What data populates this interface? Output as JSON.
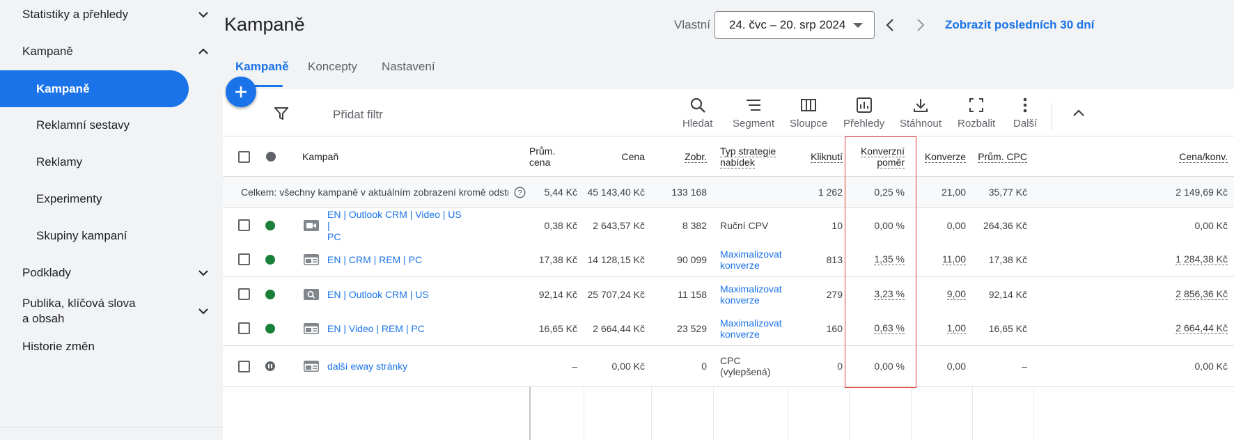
{
  "sidebar": {
    "items": [
      {
        "label": "Statistiky a přehledy",
        "chevron": "down"
      },
      {
        "label": "Kampaně",
        "chevron": "up"
      },
      {
        "label": "Kampaně",
        "active": true
      },
      {
        "label": "Reklamní sestavy"
      },
      {
        "label": "Reklamy"
      },
      {
        "label": "Experimenty"
      },
      {
        "label": "Skupiny kampaní"
      },
      {
        "label": "Podklady",
        "chevron": "down"
      },
      {
        "label": "Publika, klíčová slova",
        "label2": "a obsah",
        "chevron": "down"
      },
      {
        "label": "Historie změn"
      }
    ]
  },
  "header": {
    "title": "Kampaně",
    "date_label": "Vlastní",
    "date_range": "24. čvc – 20. srp 2024",
    "show_last": "Zobrazit posledních 30 dní"
  },
  "tabs": [
    {
      "label": "Kampaně",
      "active": true
    },
    {
      "label": "Koncepty"
    },
    {
      "label": "Nastavení"
    }
  ],
  "toolbar": {
    "add_filter": "Přidat filtr",
    "buttons": [
      {
        "label": "Hledat",
        "icon": "search-icon"
      },
      {
        "label": "Segment",
        "icon": "segment-icon"
      },
      {
        "label": "Sloupce",
        "icon": "columns-icon"
      },
      {
        "label": "Přehledy",
        "icon": "reports-icon"
      },
      {
        "label": "Stáhnout",
        "icon": "download-icon"
      },
      {
        "label": "Rozbalit",
        "icon": "expand-icon"
      },
      {
        "label": "Další",
        "icon": "more-icon"
      }
    ]
  },
  "table": {
    "headers": {
      "campaign": "Kampaň",
      "avg_cost": "Prům. cena",
      "cost": "Cena",
      "impr": "Zobr.",
      "bid_strategy_1": "Typ strategie",
      "bid_strategy_2": "nabídek",
      "clicks": "Kliknutí",
      "conv_rate_1": "Konverzní",
      "conv_rate_2": "poměr",
      "conversions": "Konverze",
      "avg_cpc": "Prům. CPC",
      "cost_conv": "Cena/konv."
    },
    "total": {
      "label": "Celkem: všechny kampaně v aktuálním zobrazení kromě odstra…",
      "avg_cost": "5,44 Kč",
      "cost": "45 143,40 Kč",
      "impr": "133 168",
      "bid": "",
      "clicks": "1 262",
      "conv_rate": "0,25 %",
      "conversions": "21,00",
      "avg_cpc": "35,77 Kč",
      "cost_conv": "2 149,69 Kč"
    },
    "rows": [
      {
        "status": "green",
        "icon": "video-icon",
        "name": "EN | Outlook CRM | Video | US |",
        "name2": "PC",
        "avg_cost": "0,38 Kč",
        "cost": "2 643,57 Kč",
        "impr": "8 382",
        "bid": "Ruční CPV",
        "bid2": "",
        "bid_link": false,
        "clicks": "10",
        "conv_rate": "0,00 %",
        "conversions": "0,00",
        "avg_cpc": "264,36 Kč",
        "cost_conv": "0,00 Kč",
        "underline": false
      },
      {
        "status": "green",
        "icon": "display-icon",
        "name": "EN | CRM | REM | PC",
        "name2": "",
        "avg_cost": "17,38 Kč",
        "cost": "14 128,15 Kč",
        "impr": "90 099",
        "bid": "Maximalizovat",
        "bid2": "konverze",
        "bid_link": true,
        "clicks": "813",
        "conv_rate": "1,35 %",
        "conversions": "11,00",
        "avg_cpc": "17,38 Kč",
        "cost_conv": "1 284,38 Kč",
        "underline": true
      },
      {
        "status": "green",
        "icon": "search-campaign-icon",
        "name": "EN | Outlook CRM | US",
        "name2": "",
        "avg_cost": "92,14 Kč",
        "cost": "25 707,24 Kč",
        "impr": "11 158",
        "bid": "Maximalizovat",
        "bid2": "konverze",
        "bid_link": true,
        "clicks": "279",
        "conv_rate": "3,23 %",
        "conversions": "9,00",
        "avg_cpc": "92,14 Kč",
        "cost_conv": "2 856,36 Kč",
        "underline": true
      },
      {
        "status": "green",
        "icon": "display-icon",
        "name": "EN | Video | REM | PC",
        "name2": "",
        "avg_cost": "16,65 Kč",
        "cost": "2 664,44 Kč",
        "impr": "23 529",
        "bid": "Maximalizovat",
        "bid2": "konverze",
        "bid_link": true,
        "clicks": "160",
        "conv_rate": "0,63 %",
        "conversions": "1,00",
        "avg_cpc": "16,65 Kč",
        "cost_conv": "2 664,44 Kč",
        "underline": true
      },
      {
        "status": "paused",
        "icon": "display-icon",
        "name": "další eway stránky",
        "name2": "",
        "avg_cost": "–",
        "cost": "0,00 Kč",
        "impr": "0",
        "bid": "CPC (vylepšená)",
        "bid2": "",
        "bid_link": false,
        "clicks": "0",
        "conv_rate": "0,00 %",
        "conversions": "0,00",
        "avg_cpc": "–",
        "cost_conv": "0,00 Kč",
        "underline": false
      }
    ]
  },
  "colors": {
    "accent": "#1a73e8",
    "status_green": "#188038",
    "highlight": "#e53935"
  }
}
